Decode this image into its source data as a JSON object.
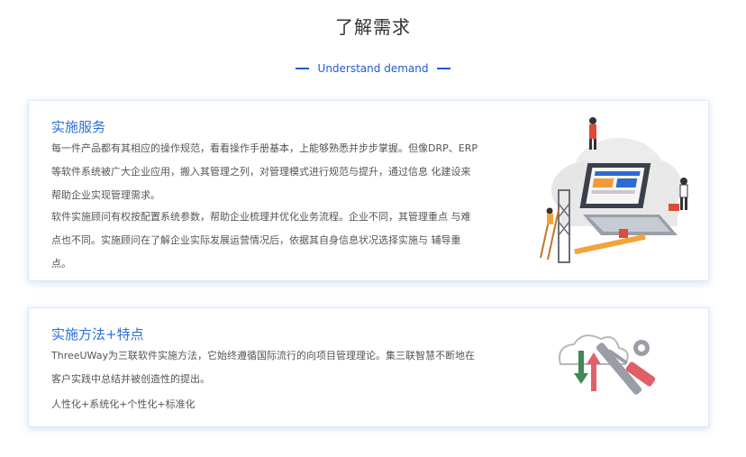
{
  "header": {
    "title": "了解需求",
    "subtitle": "Understand demand"
  },
  "section1": {
    "title": "实施服务",
    "paragraph1": "每一件产品都有其相应的操作规范，看看操作手册基本，上能够熟悉并步步掌握。但像DRP、ERP等软件系统被广大企业应用，搬入其管理之列，对管理模式进行规范与提升，通过信息 化建设来帮助企业实现管理需求。",
    "paragraph2": "软件实施顾问有权按配置系统参数，帮助企业梳理并优化业务流程。企业不同，其管理重点 与难点也不同。实施顾问在了解企业实际发展运营情况后，依据其自身信息状况选择实施与 辅导重点。",
    "illustration": "cloud-computing-illustration"
  },
  "section2": {
    "title": "实施方法+特点",
    "paragraph1": "ThreeUWay为三联软件实施方法，它始终遵循国际流行的向项目管理理论。集三联智慧不断地在客户实践中总结并被创造性的提出。",
    "paragraph2": "人性化+系统化+个性化+标准化",
    "illustration": "tools-illustration"
  },
  "colors": {
    "accent": "#2b6fd6",
    "subtitle": "#1e5bd6",
    "text": "#555555",
    "card_border": "#dbe7fb"
  }
}
